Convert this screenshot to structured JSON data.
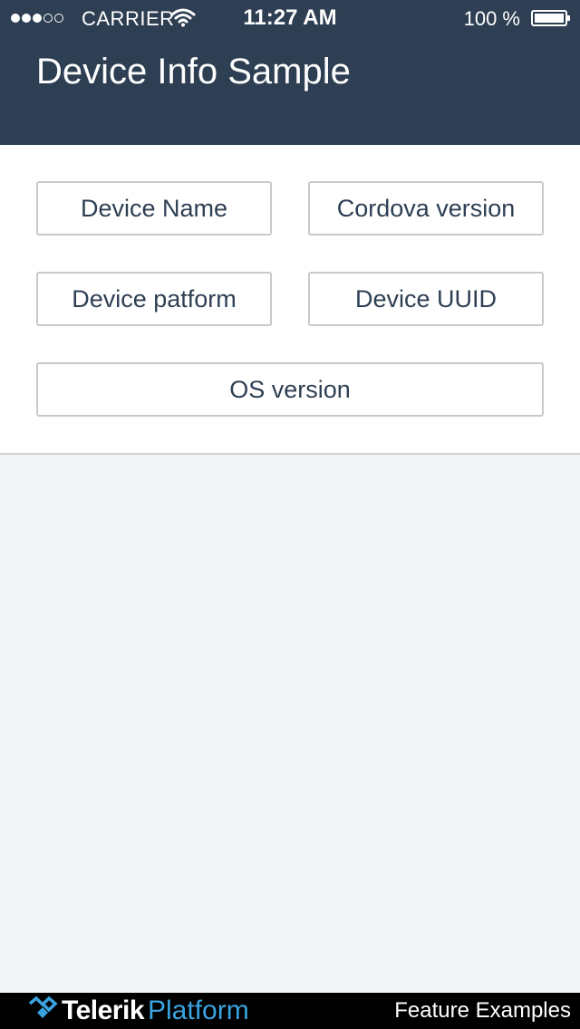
{
  "status_bar": {
    "signal_bars_filled": 3,
    "signal_bars_total": 5,
    "carrier": "CARRIER",
    "wifi_icon": "wifi-icon",
    "time": "11:27 AM",
    "battery_percent_text": "100 %",
    "battery_level": 1.0,
    "battery_icon": "battery-icon"
  },
  "nav": {
    "title": "Device Info Sample"
  },
  "buttons": {
    "device_name": "Device Name",
    "cordova_version": "Cordova version",
    "device_platform": "Device patform",
    "device_uuid": "Device UUID",
    "os_version": "OS version"
  },
  "footer": {
    "logo_telerik": "Telerik",
    "logo_platform": "Platform",
    "feature_examples": "Feature Examples"
  },
  "colors": {
    "header_bg": "#2e3f53",
    "content_bg": "#ffffff",
    "page_bg": "#f3f4f6",
    "button_text": "#2e3f53",
    "button_border": "#c6c9cd",
    "footer_bg": "#000000",
    "logo_accent": "#3aa3df"
  }
}
